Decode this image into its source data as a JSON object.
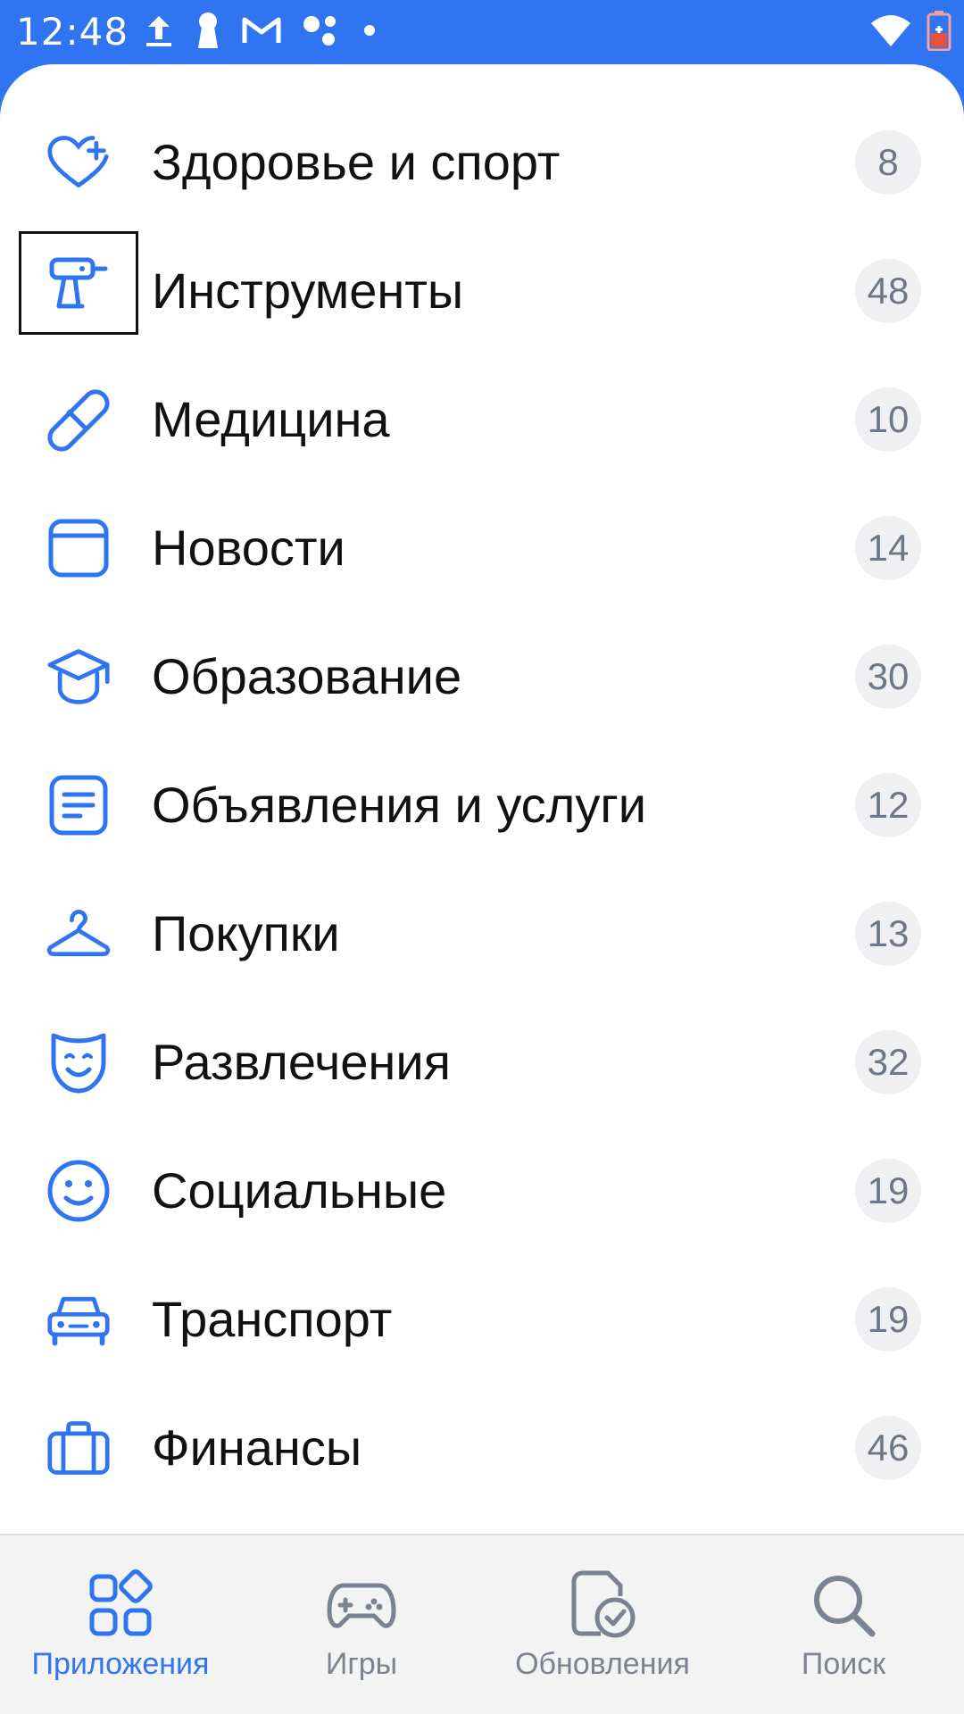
{
  "status_bar": {
    "time": "12:48",
    "left_icons": [
      "upload-icon",
      "keyhole-icon",
      "gmail-icon",
      "assistant-icon",
      "dot-icon"
    ],
    "right_icons": [
      "wifi-icon",
      "battery-icon"
    ]
  },
  "colors": {
    "accent": "#2f74f0",
    "text": "#111111",
    "badge_bg": "#f0f0f2",
    "badge_text": "#6d7787",
    "nav_bg": "#f3f3f4",
    "nav_inactive": "#7b8390"
  },
  "categories": [
    {
      "label": "Здоровье и спорт",
      "count": "8",
      "icon": "heart-plus-icon"
    },
    {
      "label": "Инструменты",
      "count": "48",
      "icon": "drill-icon"
    },
    {
      "label": "Медицина",
      "count": "10",
      "icon": "pill-icon"
    },
    {
      "label": "Новости",
      "count": "14",
      "icon": "window-icon"
    },
    {
      "label": "Образование",
      "count": "30",
      "icon": "graduation-cap-icon"
    },
    {
      "label": "Объявления и услуги",
      "count": "12",
      "icon": "document-icon"
    },
    {
      "label": "Покупки",
      "count": "13",
      "icon": "hanger-icon"
    },
    {
      "label": "Развлечения",
      "count": "32",
      "icon": "mask-icon"
    },
    {
      "label": "Социальные",
      "count": "19",
      "icon": "smile-icon"
    },
    {
      "label": "Транспорт",
      "count": "19",
      "icon": "car-icon"
    },
    {
      "label": "Финансы",
      "count": "46",
      "icon": "briefcase-icon"
    }
  ],
  "bottom_nav": [
    {
      "label": "Приложения",
      "icon": "apps-grid-icon",
      "active": true
    },
    {
      "label": "Игры",
      "icon": "gamepad-icon",
      "active": false
    },
    {
      "label": "Обновления",
      "icon": "updates-icon",
      "active": false
    },
    {
      "label": "Поиск",
      "icon": "search-icon",
      "active": false
    }
  ]
}
